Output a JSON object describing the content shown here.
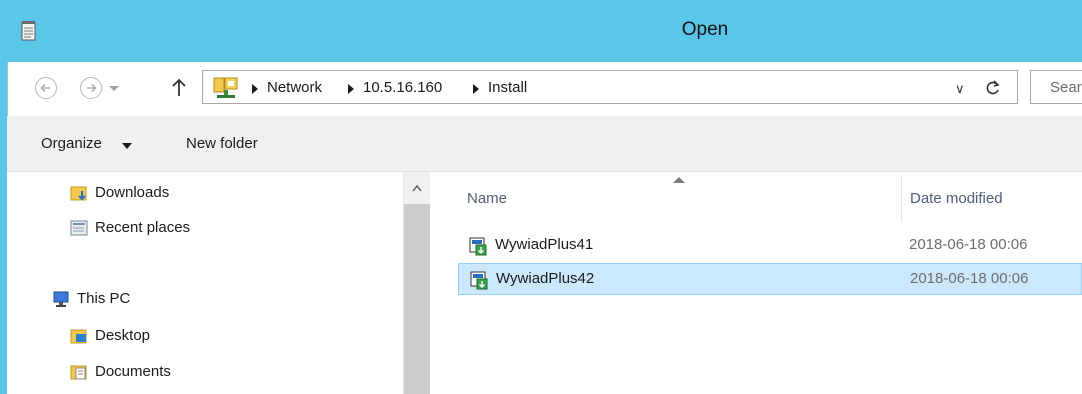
{
  "window": {
    "title": "Open",
    "icon": "notepad-icon",
    "accent_color": "#5bc7e8"
  },
  "address_bar": {
    "back_icon": "back-arrow-icon",
    "forward_icon": "forward-arrow-icon",
    "up_icon": "up-arrow-icon",
    "location_icon": "network-icon",
    "breadcrumbs": [
      "Network",
      "10.5.16.160",
      "Install"
    ],
    "dropdown_icon": "chevron-down-icon",
    "refresh_icon": "refresh-icon",
    "search_placeholder": "Searc"
  },
  "toolbar": {
    "organize_label": "Organize",
    "new_folder_label": "New folder"
  },
  "nav_pane": {
    "items": [
      {
        "label": "Downloads",
        "icon": "downloads-folder-icon"
      },
      {
        "label": "Recent places",
        "icon": "recent-places-icon"
      },
      {
        "label": "This PC",
        "icon": "computer-icon"
      },
      {
        "label": "Desktop",
        "icon": "desktop-folder-icon"
      },
      {
        "label": "Documents",
        "icon": "documents-folder-icon"
      }
    ]
  },
  "file_list": {
    "columns": [
      "Name",
      "Date modified"
    ],
    "sort_column": "Name",
    "rows": [
      {
        "name": "WywiadPlus41",
        "date": "2018-06-18 00:06",
        "icon": "installer-icon",
        "selected": false
      },
      {
        "name": "WywiadPlus42",
        "date": "2018-06-18 00:06",
        "icon": "installer-icon",
        "selected": true
      }
    ],
    "selection_color": "#cce8ff"
  }
}
